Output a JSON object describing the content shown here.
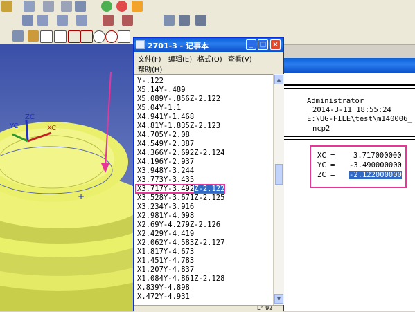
{
  "notepad": {
    "title": "2701-3 - 记事本",
    "menu": [
      "文件(F)",
      "编辑(E)",
      "格式(O)",
      "查看(V)",
      "帮助(H)"
    ],
    "lines": [
      "Y-.122",
      "X5.14Y-.489",
      "X5.089Y-.856Z-2.122",
      "X5.04Y-1.1",
      "X4.941Y-1.468",
      "X4.81Y-1.835Z-2.123",
      "X4.705Y-2.08",
      "X4.549Y-2.387",
      "X4.366Y-2.692Z-2.124",
      "X4.196Y-2.937",
      "X3.948Y-3.244",
      "X3.773Y-3.435",
      "X3.717Y-3.492",
      "X3.528Y-3.671Z-2.125",
      "X3.234Y-3.916",
      "X2.981Y-4.098",
      "X2.69Y-4.279Z-2.126",
      "X2.429Y-4.419",
      "X2.062Y-4.583Z-2.127",
      "X1.817Y-4.673",
      "X1.451Y-4.783",
      "X1.207Y-4.837",
      "X1.084Y-4.861Z-2.128",
      "X.839Y-4.898",
      "X.472Y-4.931"
    ],
    "highlight_suffix": "Z-2.122",
    "status": "Ln 92"
  },
  "info": {
    "lines": [
      "Administrator",
      "2014-3-11 18:55:24",
      "E:\\UG-FILE\\test\\m140006_",
      "ncp2"
    ],
    "xc_label": "XC =",
    "xc_value": "3.717000000",
    "yc_label": "YC =",
    "yc_value": "-3.490000000",
    "zc_label": "ZC =",
    "zc_value": "-2.122000000"
  },
  "axes": {
    "y": "YC",
    "z": "ZC",
    "x": "XC"
  },
  "colors": {
    "highlight": "#e8359a",
    "selection": "#316ac5",
    "part": "#e9f06a"
  }
}
